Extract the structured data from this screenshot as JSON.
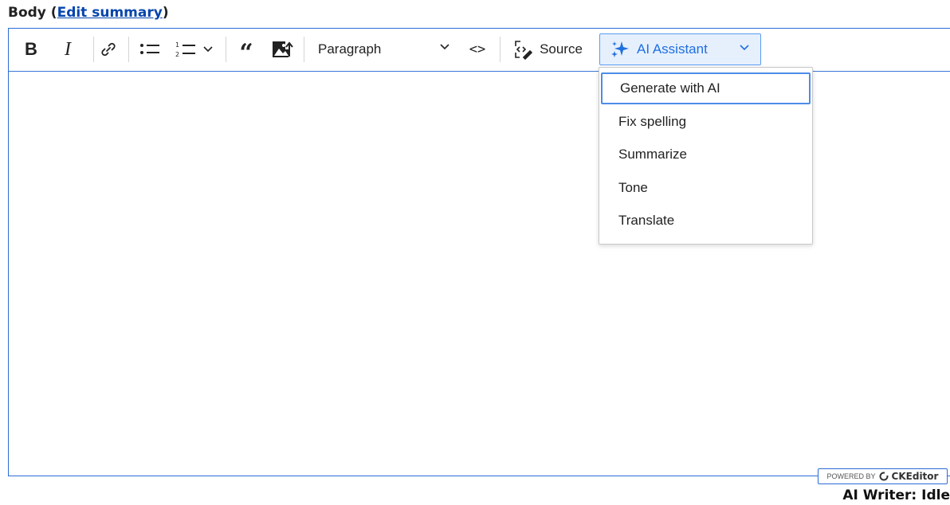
{
  "field": {
    "label_prefix": "Body (",
    "edit_summary_link": "Edit summary",
    "label_suffix": ")"
  },
  "toolbar": {
    "bold": "B",
    "italic": "I",
    "quote": "“",
    "heading_value": "Paragraph",
    "code_block": "<>",
    "source_label": "Source",
    "ai_assistant_label": "AI Assistant",
    "icons": [
      "bold-icon",
      "italic-icon",
      "link-icon",
      "bulleted-list-icon",
      "numbered-list-icon",
      "chevron-down-icon",
      "blockquote-icon",
      "image-upload-icon",
      "code-block-icon",
      "source-icon",
      "sparkle-icon"
    ]
  },
  "ai_menu": {
    "items": [
      "Generate with AI",
      "Fix spelling",
      "Summarize",
      "Tone",
      "Translate"
    ],
    "active_index": 0
  },
  "footer": {
    "powered_by": "POWERED BY",
    "brand": "CKEditor",
    "status": "AI Writer: Idle"
  },
  "colors": {
    "accent": "#1f6fe0",
    "border": "#2c6bd6",
    "ai_button_bg": "#e6f0fd",
    "link": "#0645ad"
  }
}
